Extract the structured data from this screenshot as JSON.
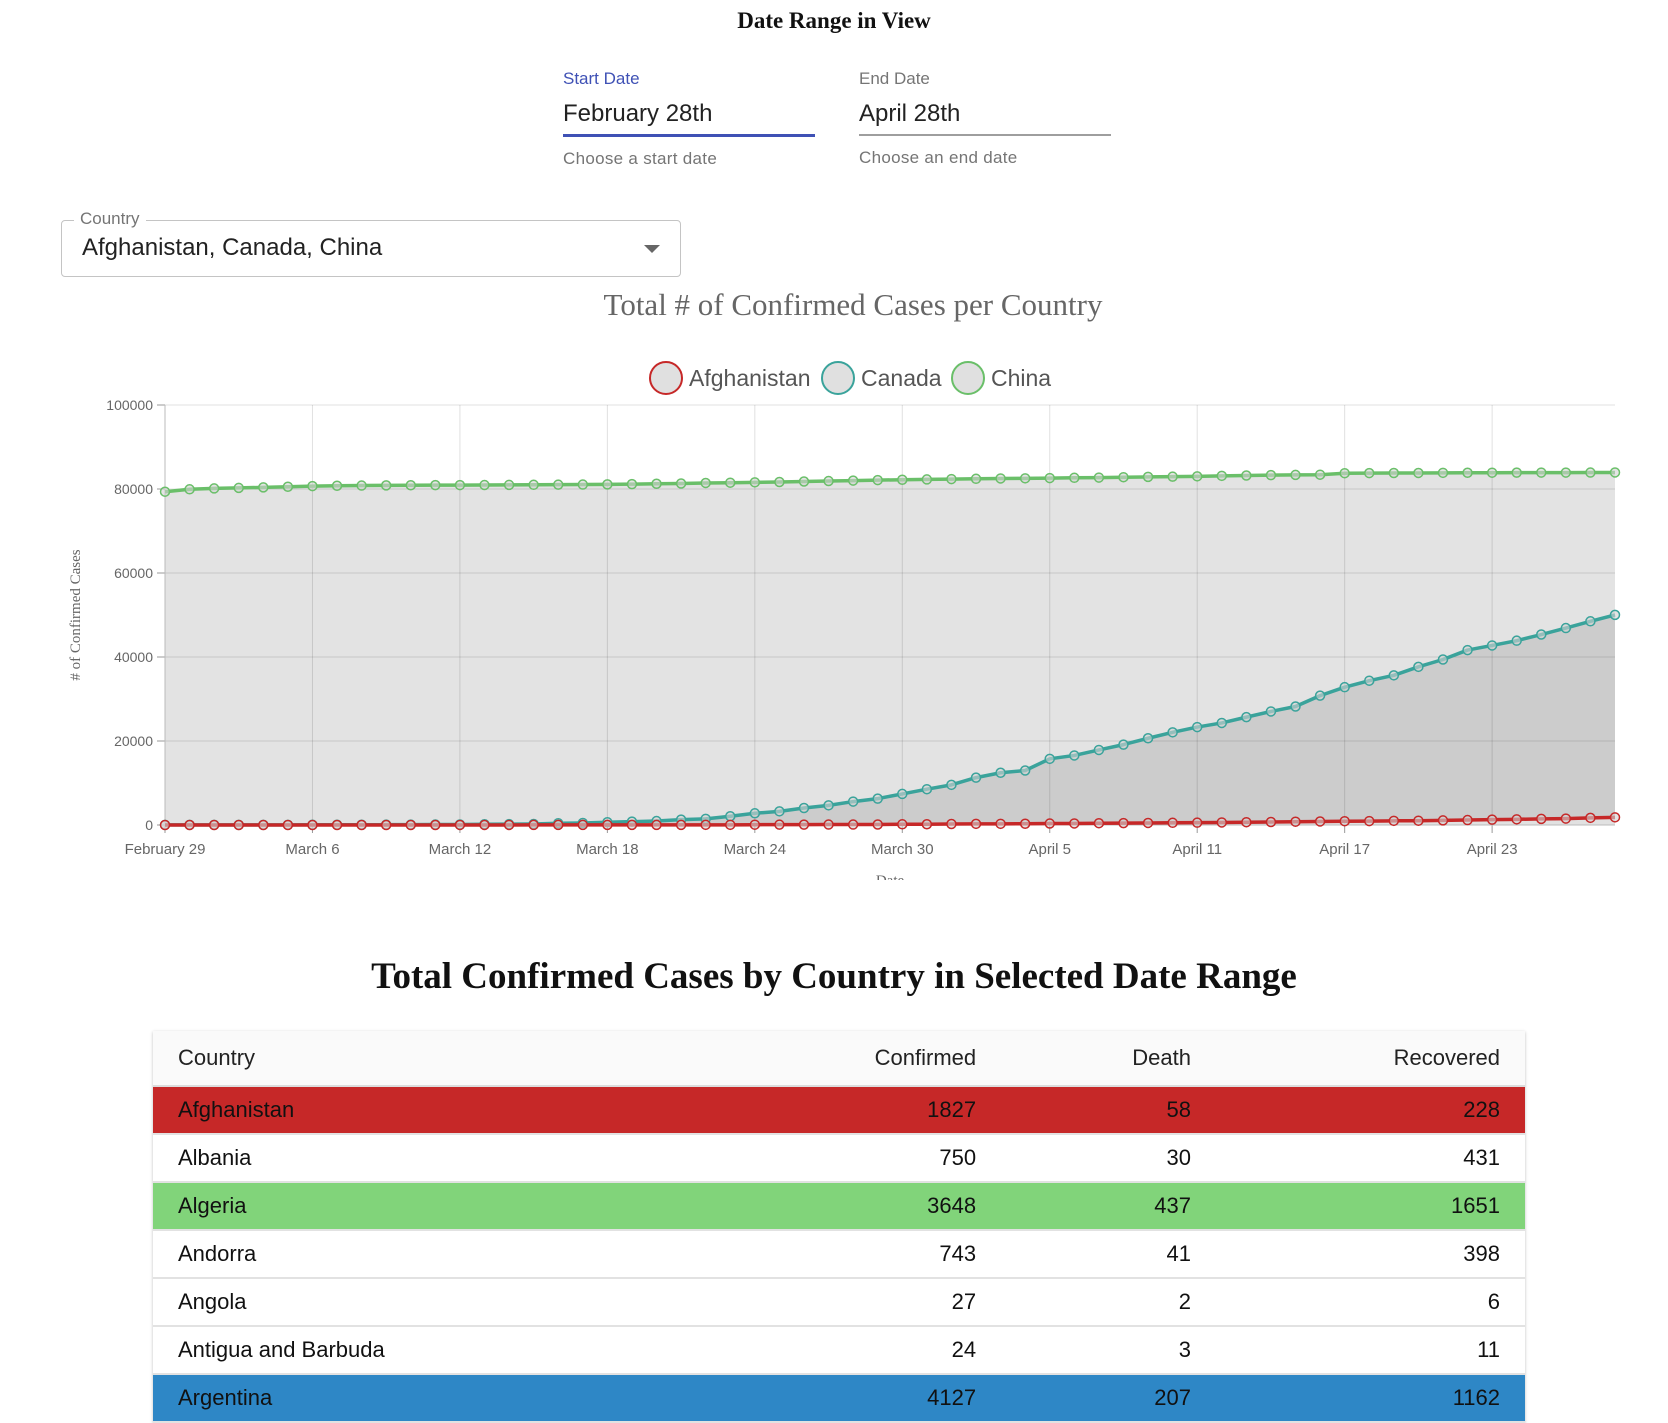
{
  "heading": "Date Range in View",
  "start_date": {
    "label": "Start Date",
    "value": "February 28th",
    "helper": "Choose a start date"
  },
  "end_date": {
    "label": "End Date",
    "value": "April 28th",
    "helper": "Choose an end date"
  },
  "country_select": {
    "label": "Country",
    "value": "Afghanistan, Canada, China"
  },
  "chart_data": {
    "type": "area",
    "title": "Total # of Confirmed Cases per Country",
    "xlabel": "Date",
    "ylabel": "# of Confirmed Cases",
    "ylim": [
      0,
      100000
    ],
    "yticks": [
      0,
      20000,
      40000,
      60000,
      80000,
      100000
    ],
    "x_start": "February 29",
    "x_end": "April 28",
    "xtick_labels": [
      "February 29",
      "March 6",
      "March 12",
      "March 18",
      "March 24",
      "March 30",
      "April 5",
      "April 11",
      "April 17",
      "April 23"
    ],
    "grid": true,
    "legend_position": "top",
    "series": [
      {
        "name": "Afghanistan",
        "color": "#c62828",
        "fill": "#e1e1e1",
        "values": [
          1,
          1,
          1,
          1,
          1,
          1,
          1,
          1,
          1,
          4,
          4,
          5,
          7,
          7,
          10,
          16,
          21,
          22,
          22,
          22,
          24,
          24,
          40,
          40,
          74,
          84,
          94,
          110,
          110,
          120,
          170,
          174,
          237,
          273,
          281,
          299,
          349,
          367,
          423,
          444,
          484,
          521,
          555,
          607,
          665,
          714,
          784,
          840,
          906,
          933,
          996,
          1026,
          1092,
          1176,
          1279,
          1351,
          1463,
          1531,
          1703,
          1828
        ]
      },
      {
        "name": "Canada",
        "color": "#3aa39b",
        "fill": "#cccccc",
        "values": [
          20,
          27,
          30,
          33,
          34,
          37,
          49,
          54,
          64,
          77,
          79,
          108,
          117,
          193,
          198,
          252,
          415,
          478,
          657,
          800,
          943,
          1277,
          1469,
          2088,
          2790,
          3251,
          4042,
          4682,
          5576,
          6280,
          7398,
          8527,
          9560,
          11284,
          12437,
          12978,
          15756,
          16563,
          17872,
          19141,
          20654,
          22059,
          23316,
          24298,
          25680,
          27035,
          28209,
          30808,
          32814,
          34356,
          35633,
          37658,
          39402,
          41650,
          42750,
          43888,
          45354,
          46895,
          48500,
          50026
        ]
      },
      {
        "name": "China",
        "color": "#6abf69",
        "fill": "#e3e3e3",
        "values": [
          79356,
          79932,
          80136,
          80261,
          80386,
          80537,
          80690,
          80770,
          80823,
          80860,
          80887,
          80921,
          80932,
          80945,
          80977,
          81003,
          81033,
          81058,
          81102,
          81156,
          81250,
          81305,
          81435,
          81498,
          81591,
          81661,
          81782,
          81897,
          81999,
          82122,
          82198,
          82279,
          82361,
          82432,
          82511,
          82543,
          82602,
          82665,
          82718,
          82809,
          82883,
          82941,
          83014,
          83134,
          83213,
          83306,
          83356,
          83403,
          83760,
          83787,
          83805,
          83817,
          83853,
          83868,
          83884,
          83899,
          83909,
          83912,
          83918,
          83940
        ]
      }
    ]
  },
  "table": {
    "title": "Total Confirmed Cases by Country in Selected Date Range",
    "headers": {
      "country": "Country",
      "confirmed": "Confirmed",
      "death": "Death",
      "recovered": "Recovered"
    },
    "rows": [
      {
        "country": "Afghanistan",
        "confirmed": "1827",
        "death": "58",
        "recovered": "228",
        "bg": "#c62828",
        "fg": "#111111"
      },
      {
        "country": "Albania",
        "confirmed": "750",
        "death": "30",
        "recovered": "431",
        "bg": "#ffffff",
        "fg": "#111111"
      },
      {
        "country": "Algeria",
        "confirmed": "3648",
        "death": "437",
        "recovered": "1651",
        "bg": "#81d47a",
        "fg": "#111111"
      },
      {
        "country": "Andorra",
        "confirmed": "743",
        "death": "41",
        "recovered": "398",
        "bg": "#ffffff",
        "fg": "#111111"
      },
      {
        "country": "Angola",
        "confirmed": "27",
        "death": "2",
        "recovered": "6",
        "bg": "#ffffff",
        "fg": "#111111"
      },
      {
        "country": "Antigua and Barbuda",
        "confirmed": "24",
        "death": "3",
        "recovered": "11",
        "bg": "#ffffff",
        "fg": "#111111"
      },
      {
        "country": "Argentina",
        "confirmed": "4127",
        "death": "207",
        "recovered": "1162",
        "bg": "#2e87c6",
        "fg": "#111111"
      }
    ]
  }
}
